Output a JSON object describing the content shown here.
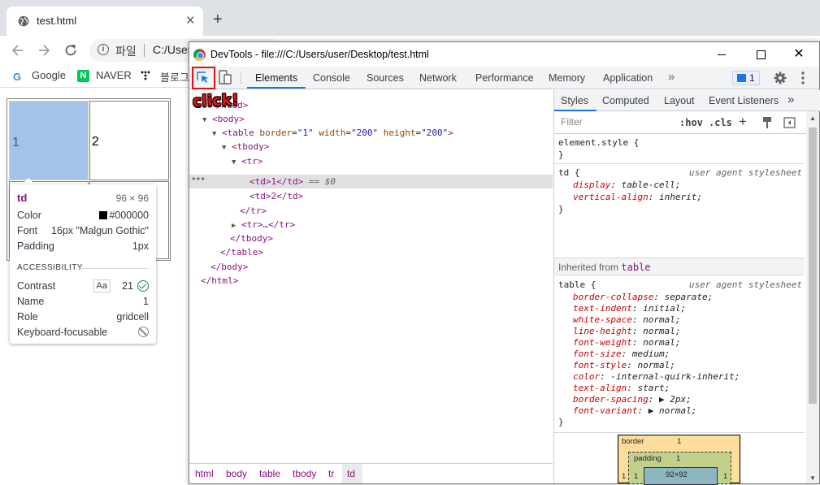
{
  "browser": {
    "tab_title": "test.html",
    "tab_close": "✕",
    "new_tab": "+",
    "omnibox_page": "파일",
    "omnibox_url": "C:/User",
    "bookmarks": [
      {
        "label": "Google"
      },
      {
        "label": "NAVER"
      },
      {
        "label": "블로그"
      }
    ]
  },
  "page": {
    "cells": [
      "1",
      "2"
    ]
  },
  "tooltip": {
    "tag": "td",
    "size": "96 × 96",
    "rows": [
      {
        "key": "Color",
        "value": "#000000"
      },
      {
        "key": "Font",
        "value": "16px \"Malgun Gothic\""
      },
      {
        "key": "Padding",
        "value": "1px"
      }
    ],
    "accessibility_title": "ACCESSIBILITY",
    "a11y": [
      {
        "key": "Contrast",
        "badge": "Aa",
        "value": "21"
      },
      {
        "key": "Name",
        "value": "1"
      },
      {
        "key": "Role",
        "value": "gridcell"
      },
      {
        "key": "Keyboard-focusable",
        "value": ""
      }
    ]
  },
  "devtools": {
    "title": "DevTools - file:///C:/Users/user/Desktop/test.html",
    "tabs": [
      "Elements",
      "Console",
      "Sources",
      "Network",
      "Performance",
      "Memory",
      "Application"
    ],
    "more_tabs": "»",
    "issues_count": "1",
    "click_annotation": "click!",
    "dom": {
      "head": "</head>",
      "body_open": "<body>",
      "table_tag": "table",
      "attrs": [
        {
          "name": "border",
          "value": "\"1\""
        },
        {
          "name": "width",
          "value": "\"200\""
        },
        {
          "name": "height",
          "value": "\"200\""
        }
      ],
      "tbody_open": "<tbody>",
      "tr_open": "<tr>",
      "td1": "<td>1</td>",
      "selected_marker": "== $0",
      "td2": "<td>2</td>",
      "tr_close": "</tr>",
      "tr_collapsed": "<tr>…</tr>",
      "tbody_close": "</tbody>",
      "table_close": "</table>",
      "body_close": "</body>",
      "html_close": "</html>"
    },
    "breadcrumbs": [
      "html",
      "body",
      "table",
      "tbody",
      "tr",
      "td"
    ],
    "styles": {
      "sub_tabs": [
        "Styles",
        "Computed",
        "Layout",
        "Event Listeners"
      ],
      "more": "»",
      "filter_placeholder": "Filter",
      "hov": ":hov",
      "cls": ".cls",
      "element_style": "element.style {",
      "close_brace": "}",
      "td_rule": {
        "selector": "td {",
        "origin": "user agent stylesheet",
        "props": [
          {
            "name": "display",
            "value": "table-cell;"
          },
          {
            "name": "vertical-align",
            "value": "inherit;"
          }
        ]
      },
      "inherited_label": "Inherited from",
      "inherited_tag": "table",
      "table_rule": {
        "selector": "table {",
        "origin": "user agent stylesheet",
        "props": [
          {
            "name": "border-collapse",
            "value": "separate;"
          },
          {
            "name": "text-indent",
            "value": "initial;"
          },
          {
            "name": "white-space",
            "value": "normal;"
          },
          {
            "name": "line-height",
            "value": "normal;"
          },
          {
            "name": "font-weight",
            "value": "normal;"
          },
          {
            "name": "font-size",
            "value": "medium;"
          },
          {
            "name": "font-style",
            "value": "normal;"
          },
          {
            "name": "color",
            "value": "-internal-quirk-inherit;"
          },
          {
            "name": "text-align",
            "value": "start;"
          },
          {
            "name": "border-spacing",
            "value": "▶ 2px;"
          },
          {
            "name": "font-variant",
            "value": "▶ normal;"
          }
        ]
      },
      "box_model": {
        "border_label": "border",
        "border_value": "1",
        "padding_label": "padding",
        "padding_value": "1",
        "side_value": "1",
        "content": "92×92"
      }
    }
  }
}
